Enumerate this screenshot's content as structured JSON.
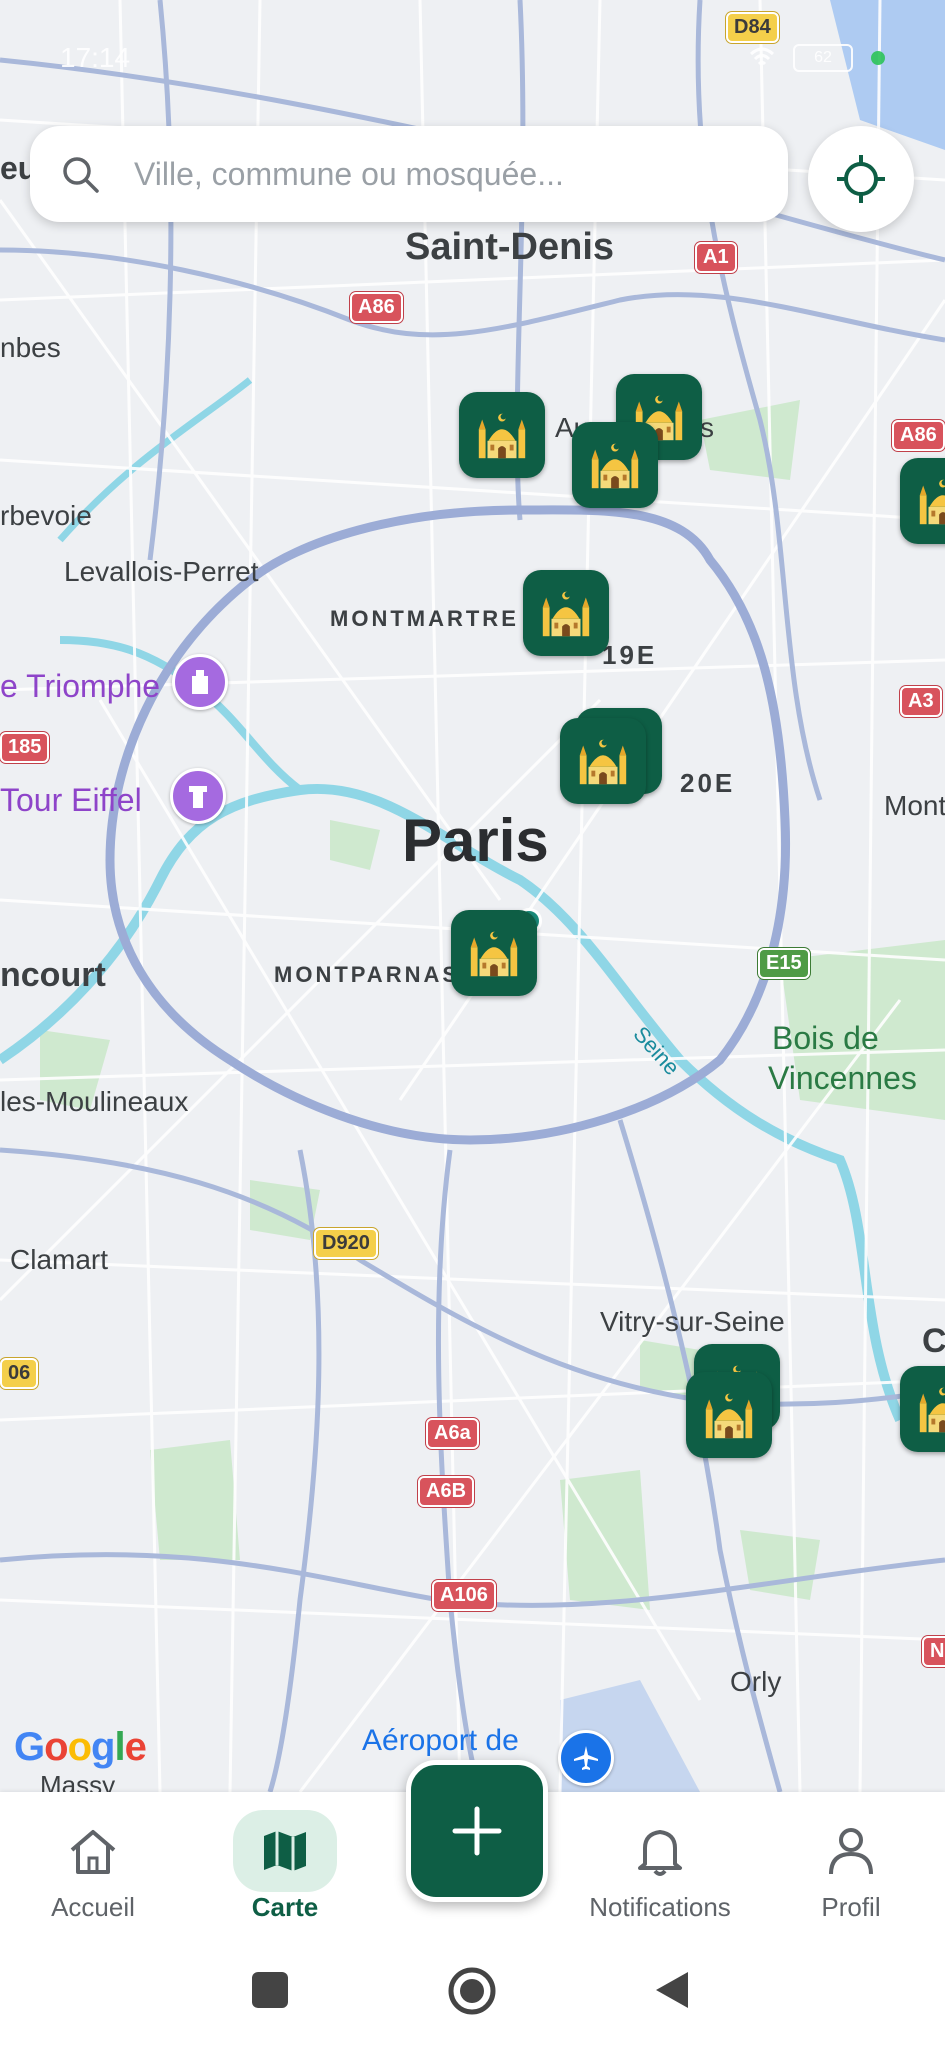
{
  "status": {
    "time": "17:14",
    "battery": "62"
  },
  "search": {
    "placeholder": "Ville, commune ou mosquée..."
  },
  "map": {
    "places": {
      "saint_denis": "Saint-Denis",
      "paris": "Paris",
      "montmartre": "MONTMARTRE",
      "montparnasse": "MONTPARNASS",
      "levallois": "Levallois-Perret",
      "courbevoie": "rbevoie",
      "colombes": "nbes",
      "arc": "e Triomphe",
      "eiffel": "Tour Eiffel",
      "boulogne": "ncourt",
      "issy": "les-Moulineaux",
      "clamart": "Clamart",
      "vitry": "Vitry-sur-Seine",
      "orly": "Orly",
      "massy": "Massy",
      "aeroport": "Aéroport de",
      "bois": "Bois de",
      "vincennes": "Vincennes",
      "d19": "19E",
      "d20": "20E",
      "seine": "Seine",
      "aub": "Au",
      "s_letter": "s",
      "mont": "Mont",
      "eu": "eu",
      "c_right": "C"
    },
    "roads": {
      "d84": "D84",
      "a1": "A1",
      "a86a": "A86",
      "a86b": "A86",
      "a3": "A3",
      "n185": "185",
      "e15": "E15",
      "d920": "D920",
      "a6a": "A6a",
      "a6b": "A6B",
      "a106": "A106",
      "n06": "06",
      "n_right": "N"
    },
    "attribution": "Google",
    "marker_icon": "mosque-icon",
    "marker_color": "#0e5e45"
  },
  "nav": {
    "items": [
      {
        "label": "Accueil",
        "icon": "home-icon"
      },
      {
        "label": "Carte",
        "icon": "map-icon",
        "active": true
      },
      {
        "label": "Notifications",
        "icon": "bell-icon"
      },
      {
        "label": "Profil",
        "icon": "user-icon"
      }
    ],
    "fab_icon": "plus-icon"
  },
  "system_nav": {
    "icons": [
      "recents-icon",
      "home-circle-icon",
      "back-icon"
    ]
  }
}
